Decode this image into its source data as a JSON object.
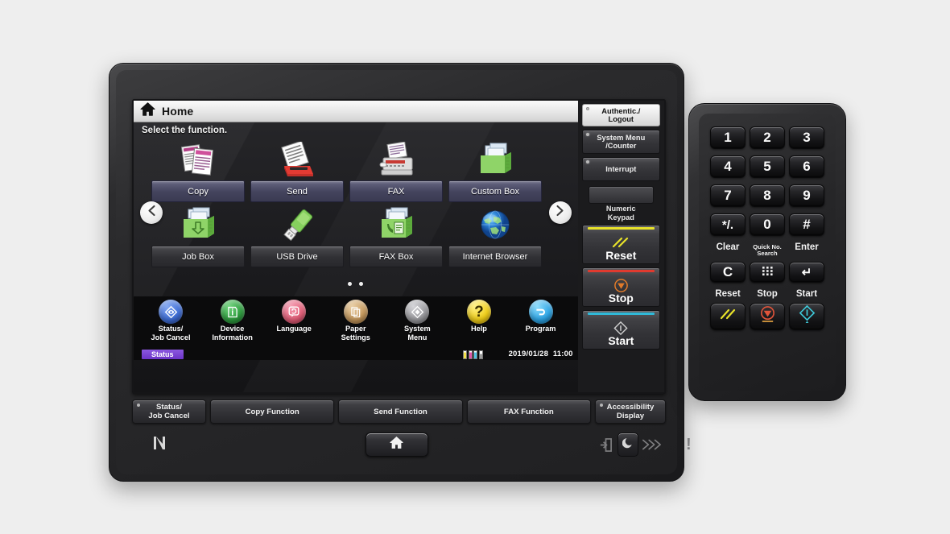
{
  "device": {
    "name": "multifunction-printer-operation-panel"
  },
  "screen": {
    "title_bar": {
      "title": "Home",
      "icon": "home-icon"
    },
    "subtitle": "Select the function.",
    "nav": {
      "prev": "‹",
      "next": "›",
      "page_dots": 2
    },
    "functions": [
      {
        "label": "Copy",
        "icon": "copy-documents-icon"
      },
      {
        "label": "Send",
        "icon": "send-scan-icon"
      },
      {
        "label": "FAX",
        "icon": "fax-machine-icon"
      },
      {
        "label": "Custom Box",
        "icon": "green-box-icon"
      },
      {
        "label": "Job Box",
        "icon": "green-box-job-icon"
      },
      {
        "label": "USB Drive",
        "icon": "usb-drive-icon"
      },
      {
        "label": "FAX Box",
        "icon": "green-box-fax-icon"
      },
      {
        "label": "Internet Browser",
        "icon": "globe-icon"
      }
    ],
    "shortcuts": [
      {
        "label": "Status/\nJob Cancel",
        "line1": "Status/",
        "line2": "Job Cancel",
        "icon": "status-diamond-icon",
        "color": "#3f6fd8"
      },
      {
        "label": "Device Information",
        "line1": "Device",
        "line2": "Information",
        "icon": "device-info-icon",
        "color": "#2f9e3f"
      },
      {
        "label": "Language",
        "line1": "Language",
        "line2": "",
        "icon": "language-icon",
        "color": "#e4607a"
      },
      {
        "label": "Paper Settings",
        "line1": "Paper",
        "line2": "Settings",
        "icon": "paper-stack-icon",
        "color": "#c79a5e"
      },
      {
        "label": "System Menu",
        "line1": "System",
        "line2": "Menu",
        "icon": "system-menu-icon",
        "color": "#9b9b9f"
      },
      {
        "label": "Help",
        "line1": "Help",
        "line2": "",
        "icon": "help-question-icon",
        "color": "#f2d019"
      },
      {
        "label": "Program",
        "line1": "Program",
        "line2": "",
        "icon": "program-arrow-icon",
        "color": "#2fa7e8"
      }
    ],
    "status_bar": {
      "badge": "Status",
      "badge_color": "#7a44d4",
      "toner": [
        {
          "name": "yellow",
          "color": "#f4e04a"
        },
        {
          "name": "magenta",
          "color": "#e255a8"
        },
        {
          "name": "cyan",
          "color": "#4fc6e8"
        },
        {
          "name": "black",
          "color": "#9a9a9a"
        }
      ],
      "date": "2019/01/28",
      "time": "11:00"
    },
    "hard_keys": [
      {
        "name": "authentic-logout",
        "line1": "Authentic./",
        "line2": "Logout",
        "led": true
      },
      {
        "name": "system-menu-counter",
        "line1": "System Menu",
        "line2": "/Counter",
        "led": true
      },
      {
        "name": "interrupt",
        "line1": "Interrupt",
        "line2": "",
        "led": true
      },
      {
        "name": "numeric-keypad",
        "line1": "Numeric",
        "line2": "Keypad",
        "led": false
      }
    ],
    "action_keys": [
      {
        "name": "reset",
        "label": "Reset",
        "bar_color": "#e8e22a",
        "glyph": "double-slash-icon"
      },
      {
        "name": "stop",
        "label": "Stop",
        "bar_color": "#e03a2f",
        "glyph": "stop-triangle-icon"
      },
      {
        "name": "start",
        "label": "Start",
        "bar_color": "#2fb9d8",
        "glyph": "start-diamond-icon"
      }
    ],
    "tabs": [
      {
        "label_line1": "Status/",
        "label_line2": "Job Cancel",
        "led": true,
        "wide": false
      },
      {
        "label_line1": "Copy Function",
        "label_line2": "",
        "led": false,
        "wide": true
      },
      {
        "label_line1": "Send Function",
        "label_line2": "",
        "led": false,
        "wide": true
      },
      {
        "label_line1": "FAX Function",
        "label_line2": "",
        "led": false,
        "wide": true
      },
      {
        "label_line1": "Accessibility",
        "label_line2": "Display",
        "led": true,
        "wide": false
      }
    ]
  },
  "bezel": {
    "nfc_icon": "nfc-icon",
    "home_button_icon": "home-icon",
    "indicators": [
      {
        "name": "data-indicator",
        "icon": "data-arrow-icon"
      },
      {
        "name": "processing-indicator",
        "icon": "chevrons-right-icon"
      },
      {
        "name": "attention-indicator",
        "icon": "exclamation-icon",
        "glyph": "!"
      }
    ],
    "power_button_icon": "power-moon-icon"
  },
  "keypad": {
    "keys": [
      [
        "1",
        "2",
        "3"
      ],
      [
        "4",
        "5",
        "6"
      ],
      [
        "7",
        "8",
        "9"
      ],
      [
        "*/.",
        "0",
        "#"
      ]
    ],
    "captions_top": [
      {
        "text": "Clear",
        "small": false
      },
      {
        "text": "Quick No. Search",
        "small": true,
        "line1": "Quick No.",
        "line2": "Search"
      },
      {
        "text": "Enter",
        "small": false
      }
    ],
    "function_keys": [
      {
        "name": "clear-key",
        "glyph": "C"
      },
      {
        "name": "quick-no-search-key",
        "glyph": "keypad-dots-icon"
      },
      {
        "name": "enter-key",
        "glyph": "↵"
      }
    ],
    "captions_bottom": [
      "Reset",
      "Stop",
      "Start"
    ],
    "action_keys": [
      {
        "name": "reset-key",
        "glyph": "double-slash-icon",
        "color": "#e8e22a"
      },
      {
        "name": "stop-key",
        "glyph": "stop-triangle-icon",
        "color": "#e0543a"
      },
      {
        "name": "start-key",
        "glyph": "start-diamond-icon",
        "color": "#3ec8d8"
      }
    ]
  }
}
